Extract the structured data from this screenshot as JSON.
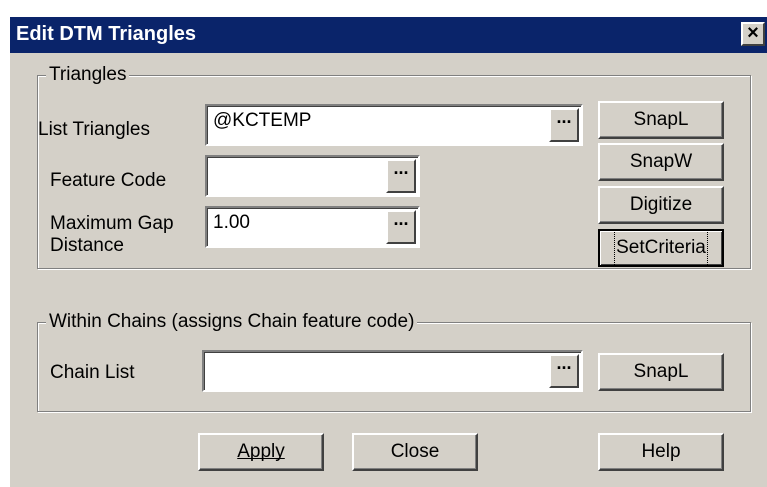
{
  "window": {
    "title": "Edit DTM Triangles",
    "close_glyph": "×"
  },
  "triangles": {
    "legend": "Triangles",
    "list_label": "List Triangles",
    "list_value": "@KCTEMP",
    "feature_label": "Feature Code",
    "feature_value": "",
    "gap_label_line1": "Maximum Gap",
    "gap_label_line2": "Distance",
    "gap_value": "1.00",
    "buttons": {
      "snapl": "SnapL",
      "snapw": "SnapW",
      "digitize": "Digitize",
      "setcriteria": "SetCriteria"
    }
  },
  "chains": {
    "legend": "Within Chains (assigns Chain feature code)",
    "chain_label": "Chain List",
    "chain_value": "",
    "snapl": "SnapL"
  },
  "browse_glyph": "...",
  "footer": {
    "apply": "Apply",
    "close": "Close",
    "help": "Help"
  }
}
